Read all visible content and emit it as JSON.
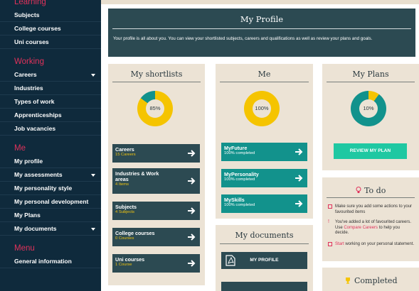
{
  "sidebar": {
    "learning_heading": "Learning",
    "learning_items": [
      "Subjects",
      "College courses",
      "Uni courses"
    ],
    "working_heading": "Working",
    "working_items": [
      "Careers",
      "Industries",
      "Types of work",
      "Apprenticeships",
      "Job vacancies"
    ],
    "me_heading": "Me",
    "me_items": [
      "My profile",
      "My assessments",
      "My personality style",
      "My personal development",
      "My Plans",
      "My documents"
    ],
    "menu_heading": "Menu",
    "menu_items": [
      "General information"
    ]
  },
  "header": {
    "title": "My Profile",
    "description": "Your profile is all about you. You can view your shortlisted subjects, careers and qualifications as well as review your plans and goals."
  },
  "shortlists": {
    "title": "My shortlists",
    "percent": 85,
    "percent_label": "85%",
    "tiles": [
      {
        "label": "Careers",
        "sub": "15 Careers"
      },
      {
        "label": "Industries & Work areas",
        "sub": "4 Items"
      },
      {
        "label": "Subjects",
        "sub": "4 Subjects"
      },
      {
        "label": "College courses",
        "sub": "0 Courses"
      },
      {
        "label": "Uni courses",
        "sub": "1 Course"
      }
    ]
  },
  "me": {
    "title": "Me",
    "percent": 100,
    "percent_label": "100%",
    "tiles": [
      {
        "label": "MyFuture",
        "sub": "100% completed"
      },
      {
        "label": "MyPersonality",
        "sub": "100% completed"
      },
      {
        "label": "MySkills",
        "sub": "100% completed"
      }
    ]
  },
  "documents": {
    "title": "My documents",
    "profile_button": "MY PROFILE"
  },
  "plans": {
    "title": "My Plans",
    "percent": 10,
    "percent_label": "10%",
    "review_button": "REVIEW MY PLAN"
  },
  "todo": {
    "title": "To do",
    "item1": "Make sure you add some actions to your favourited items",
    "item2_a": "You've added a lot of favourited careers. Use ",
    "item2_link": "Compare Careers",
    "item2_b": " to help you decide.",
    "item3_link": "Start",
    "item3_b": " working on your personal statement."
  },
  "completed": {
    "title": "Completed"
  },
  "colors": {
    "sidebar_bg": "#0f2a3c",
    "section_heading": "#e0325b",
    "card_bg": "#ece3d5",
    "header_bg": "#2c4a52",
    "donut_primary": "#f5c400",
    "donut_teal": "#12928c",
    "tile_dark": "#2c4a52",
    "tile_teal": "#12928c",
    "review_button": "#1fc8a2"
  }
}
